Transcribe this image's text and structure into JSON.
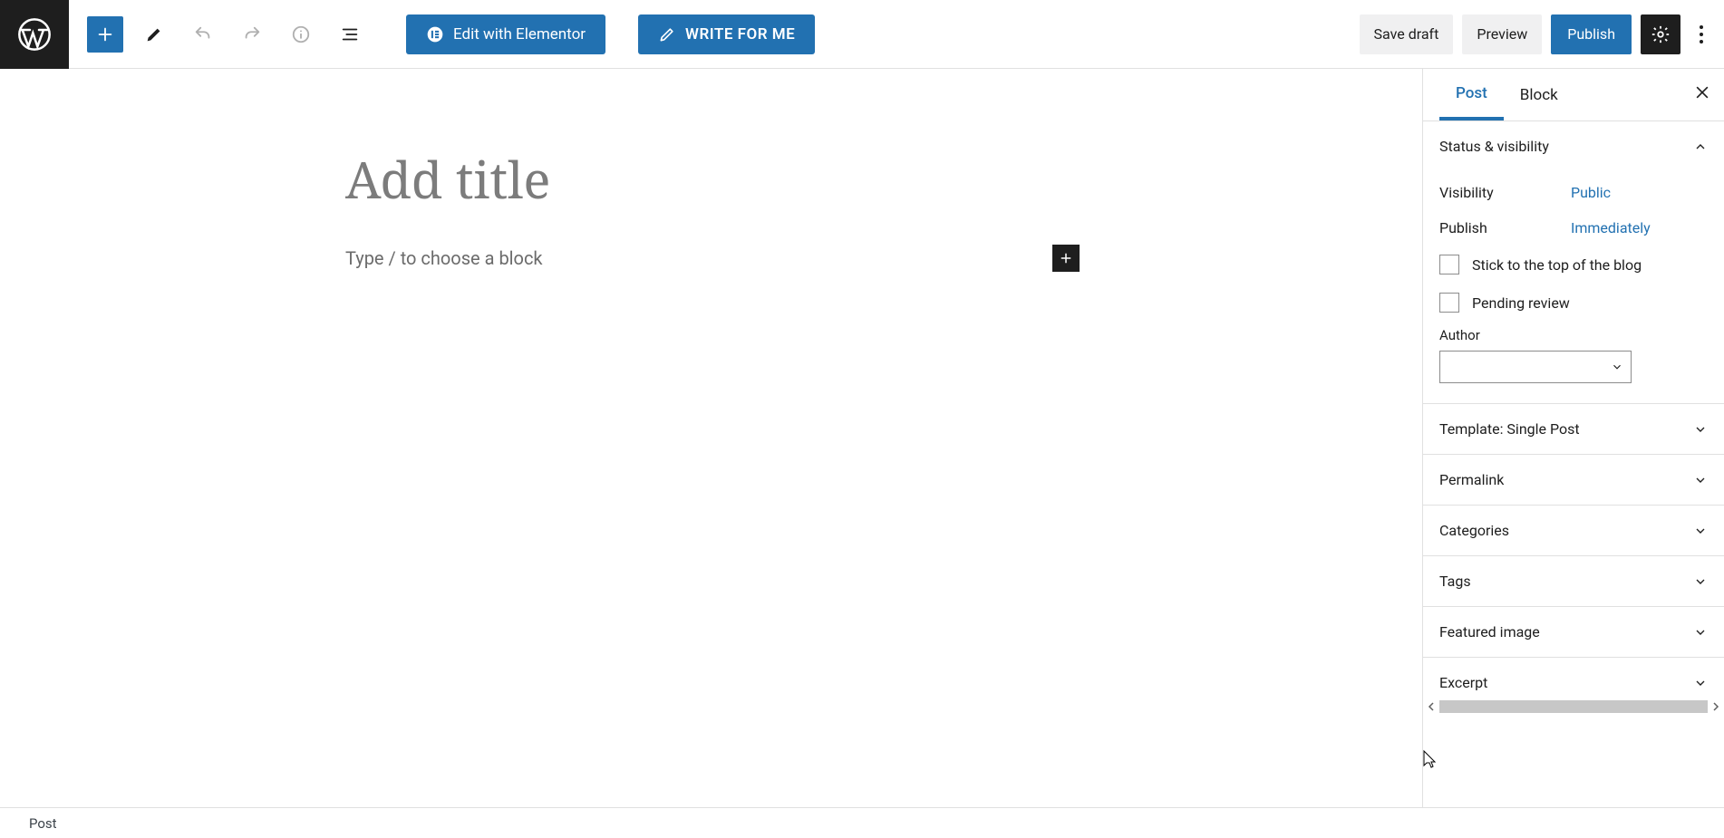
{
  "toolbar": {
    "edit_with_elementor": "Edit with Elementor",
    "write_for_me": "WRITE FOR ME",
    "save_draft": "Save draft",
    "preview": "Preview",
    "publish": "Publish"
  },
  "editor": {
    "title_placeholder": "Add title",
    "content_placeholder": "Type / to choose a block"
  },
  "sidebar": {
    "tabs": {
      "post": "Post",
      "block": "Block"
    },
    "status": {
      "title": "Status & visibility",
      "visibility_label": "Visibility",
      "visibility_value": "Public",
      "publish_label": "Publish",
      "publish_value": "Immediately",
      "stick_top": "Stick to the top of the blog",
      "pending_review": "Pending review",
      "author_label": "Author"
    },
    "panels": {
      "template": "Template: Single Post",
      "permalink": "Permalink",
      "categories": "Categories",
      "tags": "Tags",
      "featured_image": "Featured image",
      "excerpt": "Excerpt"
    }
  },
  "footer": {
    "breadcrumb": "Post"
  }
}
